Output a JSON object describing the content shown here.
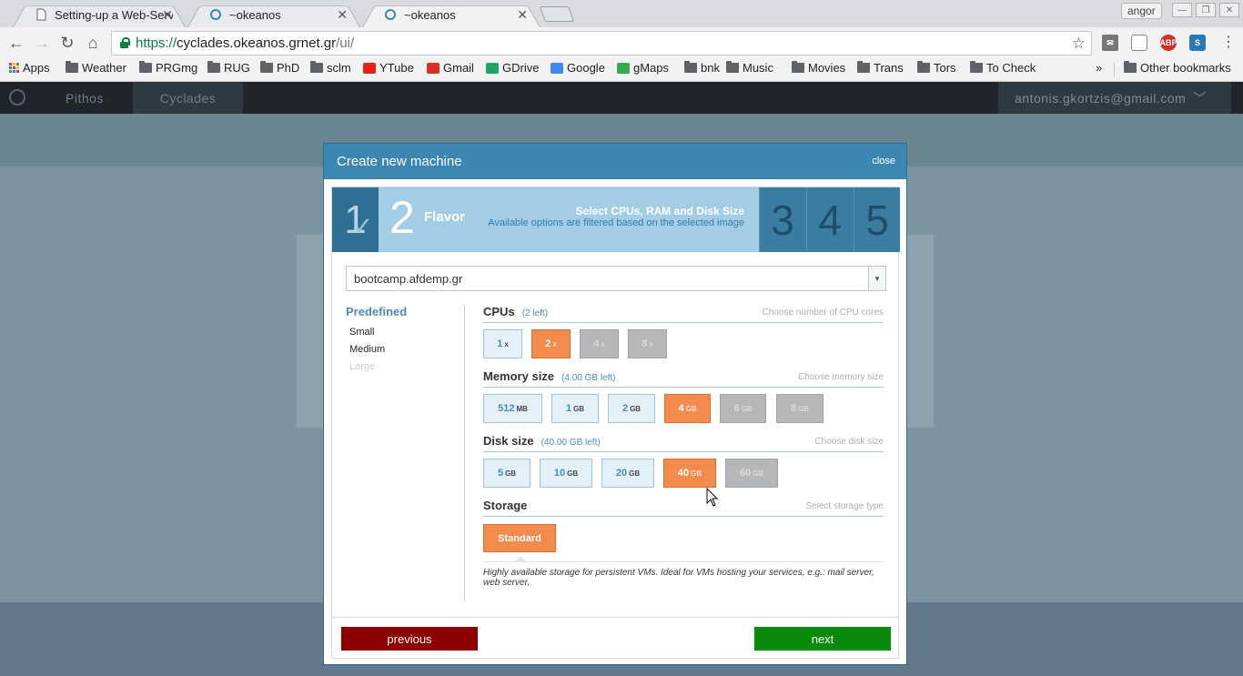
{
  "browser": {
    "tabs": [
      {
        "title": "Setting-up a Web-Serve",
        "active": false
      },
      {
        "title": "~okeanos",
        "active": false
      },
      {
        "title": "~okeanos",
        "active": true
      }
    ],
    "profile_name": "angor",
    "url": {
      "scheme": "https://",
      "host": "cyclades.okeanos.grnet.gr",
      "path": "/ui/"
    },
    "bookmarks": [
      {
        "label": "Apps",
        "icon": "apps-grid-icon"
      },
      {
        "label": "Weather",
        "icon": "folder-icon"
      },
      {
        "label": "PRGmg",
        "icon": "folder-icon"
      },
      {
        "label": "RUG",
        "icon": "folder-icon"
      },
      {
        "label": "PhD",
        "icon": "folder-icon"
      },
      {
        "label": "sclm",
        "icon": "folder-icon"
      },
      {
        "label": "YTube",
        "icon": "youtube-icon"
      },
      {
        "label": "Gmail",
        "icon": "gmail-icon"
      },
      {
        "label": "GDrive",
        "icon": "gdrive-icon"
      },
      {
        "label": "Google",
        "icon": "google-icon"
      },
      {
        "label": "gMaps",
        "icon": "gmaps-icon"
      },
      {
        "label": "bnk",
        "icon": "folder-icon"
      },
      {
        "label": "Music",
        "icon": "folder-icon"
      },
      {
        "label": "Movies",
        "icon": "folder-icon"
      },
      {
        "label": "Trans",
        "icon": "folder-icon"
      },
      {
        "label": "Tors",
        "icon": "folder-icon"
      },
      {
        "label": "To Check",
        "icon": "folder-icon"
      }
    ],
    "overflow": "»",
    "other_bookmarks": "Other bookmarks"
  },
  "app": {
    "nav": [
      "Pithos",
      "Cyclades"
    ],
    "user_email": "antonis.gkortzis@gmail.com"
  },
  "modal": {
    "title": "Create new machine",
    "close_label": "close",
    "steps": {
      "done": "1",
      "current_number": "2",
      "current_label": "Flavor",
      "current_title": "Select CPUs, RAM and Disk Size",
      "current_subtitle": "Available options are filtered based on the selected image",
      "next": [
        "3",
        "4",
        "5"
      ]
    },
    "image_select": "bootcamp.afdemp.gr",
    "predefined": {
      "title": "Predefined",
      "items": [
        "Small",
        "Medium",
        "Large"
      ]
    },
    "cpus": {
      "title": "CPUs",
      "left": "(2 left)",
      "hint": "Choose number of CPU cores",
      "options": [
        {
          "value": "1",
          "unit": "x",
          "state": "available"
        },
        {
          "value": "2",
          "unit": "x",
          "state": "selected"
        },
        {
          "value": "4",
          "unit": "x",
          "state": "disabled"
        },
        {
          "value": "8",
          "unit": "x",
          "state": "disabled"
        }
      ]
    },
    "memory": {
      "title": "Memory size",
      "left": "(4.00 GB left)",
      "hint": "Choose memory size",
      "options": [
        {
          "value": "512",
          "unit": "MB",
          "state": "available"
        },
        {
          "value": "1",
          "unit": "GB",
          "state": "available"
        },
        {
          "value": "2",
          "unit": "GB",
          "state": "available"
        },
        {
          "value": "4",
          "unit": "GB",
          "state": "selected"
        },
        {
          "value": "6",
          "unit": "GB",
          "state": "disabled"
        },
        {
          "value": "8",
          "unit": "GB",
          "state": "disabled"
        }
      ]
    },
    "disk": {
      "title": "Disk size",
      "left": "(40.00 GB left)",
      "hint": "Choose disk size",
      "options": [
        {
          "value": "5",
          "unit": "GB",
          "state": "available"
        },
        {
          "value": "10",
          "unit": "GB",
          "state": "available"
        },
        {
          "value": "20",
          "unit": "GB",
          "state": "available"
        },
        {
          "value": "40",
          "unit": "GB",
          "state": "selected"
        },
        {
          "value": "60",
          "unit": "GB",
          "state": "disabled"
        }
      ]
    },
    "storage": {
      "title": "Storage",
      "hint": "Select storage type",
      "option": "Standard",
      "description": "Highly available storage for persistent VMs. Ideal for VMs hosting your services, e.g.: mail server, web server."
    },
    "previous_label": "previous",
    "next_label": "next"
  },
  "colors": {
    "modal_header": "#3b87b2",
    "selected": "#f28b4c",
    "previous": "#8c0000",
    "next": "#0a8a0a"
  }
}
